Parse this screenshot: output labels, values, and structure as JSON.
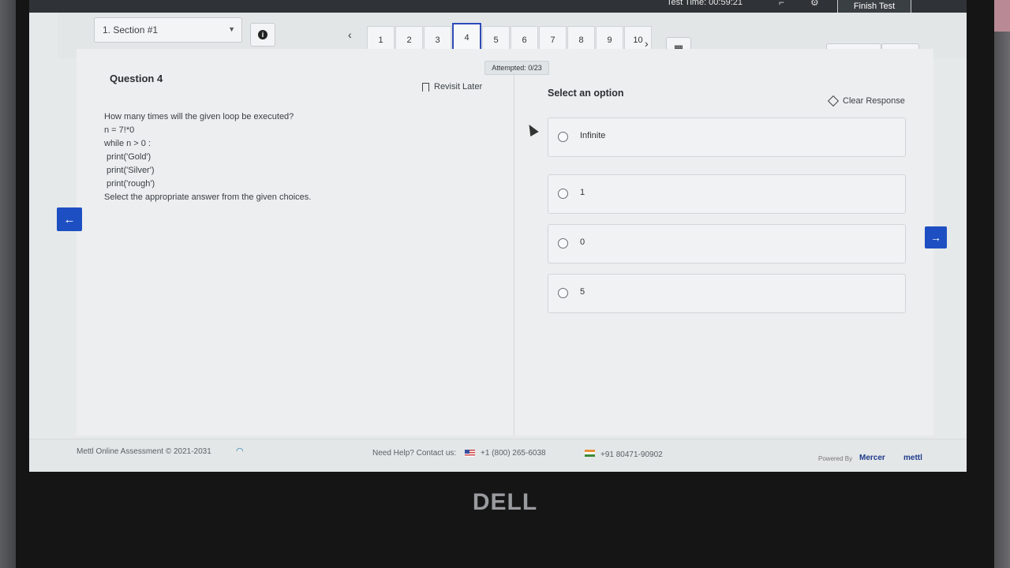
{
  "header": {
    "timer_text": "Test Time: 00:59:21",
    "finish_label": "Finish Test",
    "small_icons": [
      "collapse-icon",
      "gear-icon"
    ]
  },
  "section": {
    "selected": "1. Section #1"
  },
  "pager": {
    "numbers": [
      "1",
      "2",
      "3",
      "4",
      "5",
      "6",
      "7",
      "8",
      "9",
      "10"
    ],
    "current": "4",
    "attempted": "Attempted: 0/23",
    "previous_label": "Previous",
    "next_label": "Next"
  },
  "question": {
    "title": "Question 4",
    "revisit_label": "Revisit Later",
    "lines": [
      "How many times will the given loop be executed?",
      "n = 7!*0",
      "while n > 0 :",
      " print('Gold')",
      " print('Silver')",
      " print('rough')",
      "Select the appropriate answer from the given choices."
    ]
  },
  "answers": {
    "select_title": "Select an option",
    "clear_label": "Clear Response",
    "options": [
      "Infinite",
      "1",
      "0",
      "5"
    ]
  },
  "footer": {
    "copyright": "Mettl Online Assessment © 2021-2031",
    "help_text": "Need Help? Contact us:",
    "phone_us": "+1 (800) 265-6038",
    "phone_in": "+91 80471-90902",
    "powered_by": "Powered By",
    "brand1": "Mercer",
    "brand2": "mettl"
  },
  "device": {
    "brand": "DELL"
  },
  "colors": {
    "accent": "#1e4fc2",
    "current_question_border": "#2f4bb8"
  }
}
